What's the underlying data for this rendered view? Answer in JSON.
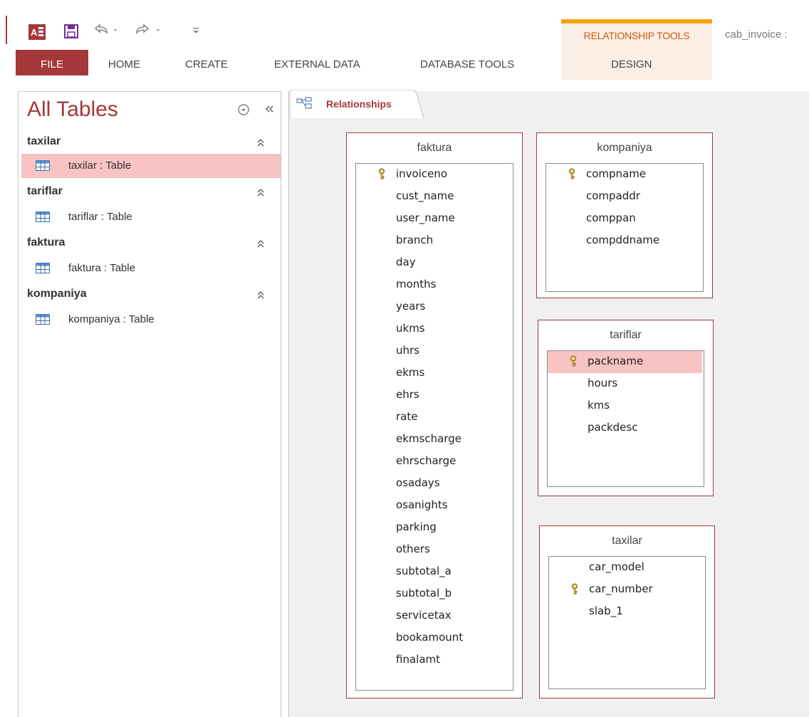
{
  "window": {
    "context_group": "RELATIONSHIP TOOLS",
    "document_title": "cab_invoice :"
  },
  "ribbon_tabs": {
    "file": "FILE",
    "home": "HOME",
    "create": "CREATE",
    "external_data": "EXTERNAL DATA",
    "database_tools": "DATABASE TOOLS",
    "design": "DESIGN"
  },
  "nav": {
    "title": "All Tables",
    "groups": [
      {
        "name": "taxilar",
        "item": "taxilar : Table",
        "selected": true
      },
      {
        "name": "tariflar",
        "item": "tariflar : Table",
        "selected": false
      },
      {
        "name": "faktura",
        "item": "faktura : Table",
        "selected": false
      },
      {
        "name": "kompaniya",
        "item": "kompaniya : Table",
        "selected": false
      }
    ]
  },
  "document_tab": {
    "label": "Relationships"
  },
  "tables": [
    {
      "name": "faktura",
      "fields": [
        {
          "name": "invoiceno",
          "key": true
        },
        {
          "name": "cust_name"
        },
        {
          "name": "user_name"
        },
        {
          "name": "branch"
        },
        {
          "name": "day"
        },
        {
          "name": "months"
        },
        {
          "name": "years"
        },
        {
          "name": "ukms"
        },
        {
          "name": "uhrs"
        },
        {
          "name": "ekms"
        },
        {
          "name": "ehrs"
        },
        {
          "name": "rate"
        },
        {
          "name": "ekmscharge"
        },
        {
          "name": "ehrscharge"
        },
        {
          "name": "osadays"
        },
        {
          "name": "osanights"
        },
        {
          "name": "parking"
        },
        {
          "name": "others"
        },
        {
          "name": "subtotal_a"
        },
        {
          "name": "subtotal_b"
        },
        {
          "name": "servicetax"
        },
        {
          "name": "bookamount"
        },
        {
          "name": "finalamt"
        }
      ]
    },
    {
      "name": "kompaniya",
      "fields": [
        {
          "name": "compname",
          "key": true
        },
        {
          "name": "compaddr"
        },
        {
          "name": "comppan"
        },
        {
          "name": "compddname"
        }
      ]
    },
    {
      "name": "tariflar",
      "fields": [
        {
          "name": "packname",
          "key": true,
          "selected": true
        },
        {
          "name": "hours"
        },
        {
          "name": "kms"
        },
        {
          "name": "packdesc"
        }
      ]
    },
    {
      "name": "taxilar",
      "fields": [
        {
          "name": "car_model"
        },
        {
          "name": "car_number",
          "key": true
        },
        {
          "name": "slab_1"
        }
      ]
    }
  ],
  "colors": {
    "brand": "#a4373a",
    "context_accent": "#f5a30d",
    "selection": "#f8c3c3"
  }
}
